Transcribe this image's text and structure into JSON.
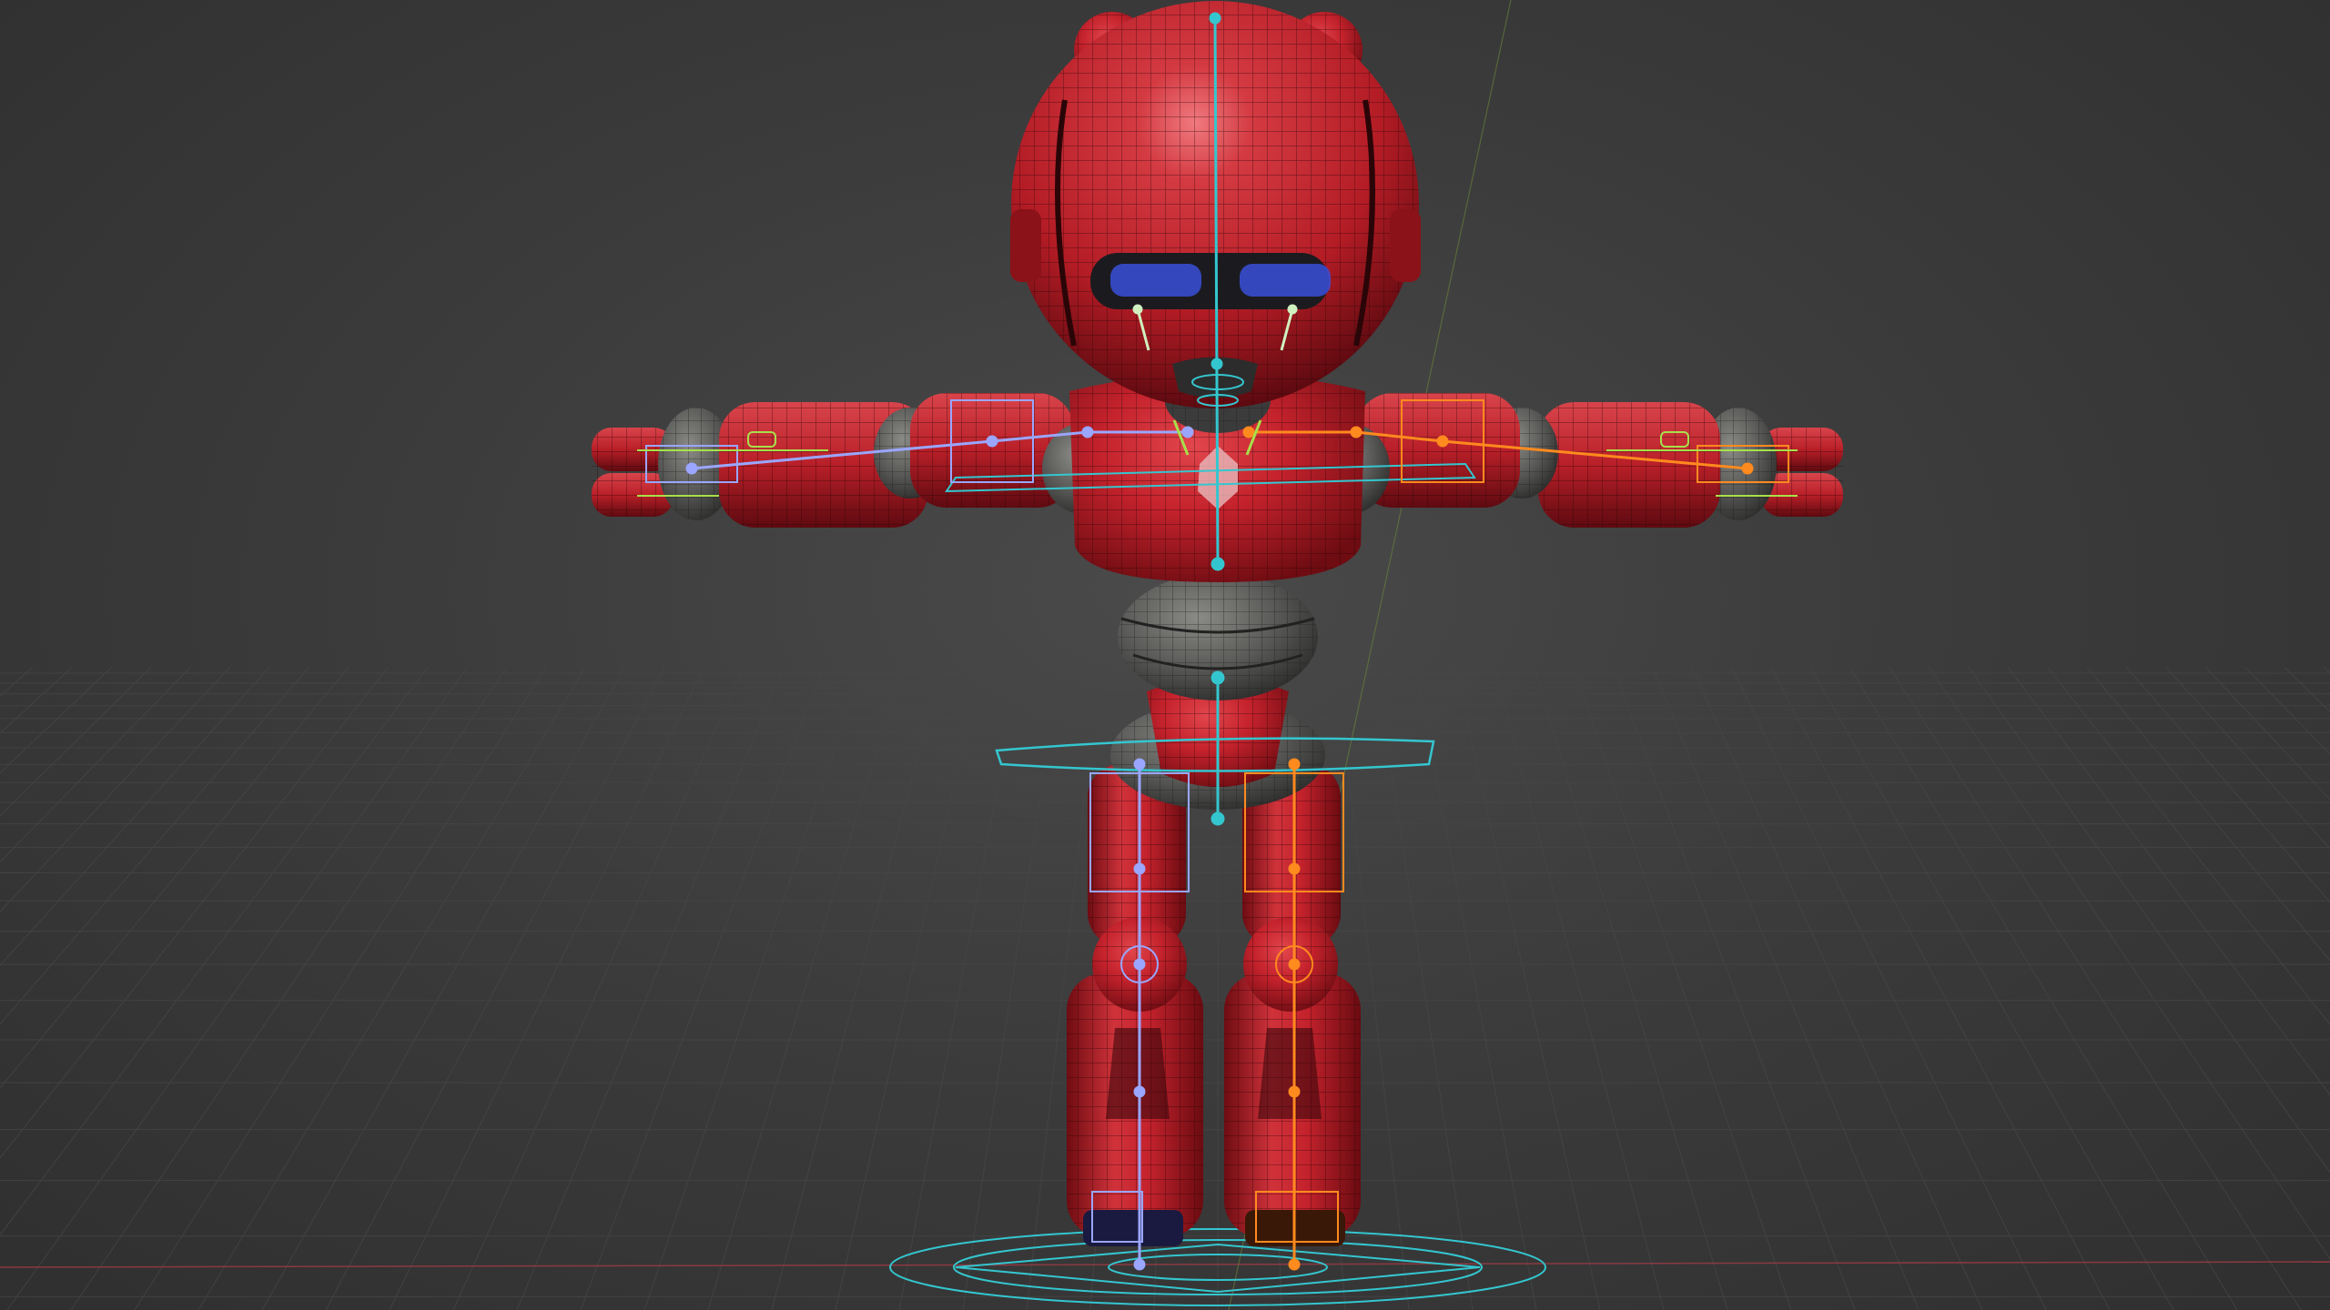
{
  "viewport": {
    "mode": "3d-viewport",
    "object": "robot-character-rig",
    "background_color": "#3a3a3a",
    "grid_color": "#4a4a4a",
    "x_axis_color": "#a03b46",
    "y_axis_color": "#6f8a3a"
  },
  "character": {
    "body_color": "#c4222c",
    "body_shadow_color": "#6e0c12",
    "joint_color": "#5a5a58",
    "visor_color": "#1b1b1f",
    "eye_color": "#3a4fd8",
    "wire_color": "#2a0508"
  },
  "rig": {
    "center_bone_color": "#34c6cf",
    "left_side_color": "#9aa6ff",
    "right_side_color": "#ff8a1e",
    "control_ring_color": "#34c6cf",
    "fk_line_color": "#a8e04a"
  }
}
